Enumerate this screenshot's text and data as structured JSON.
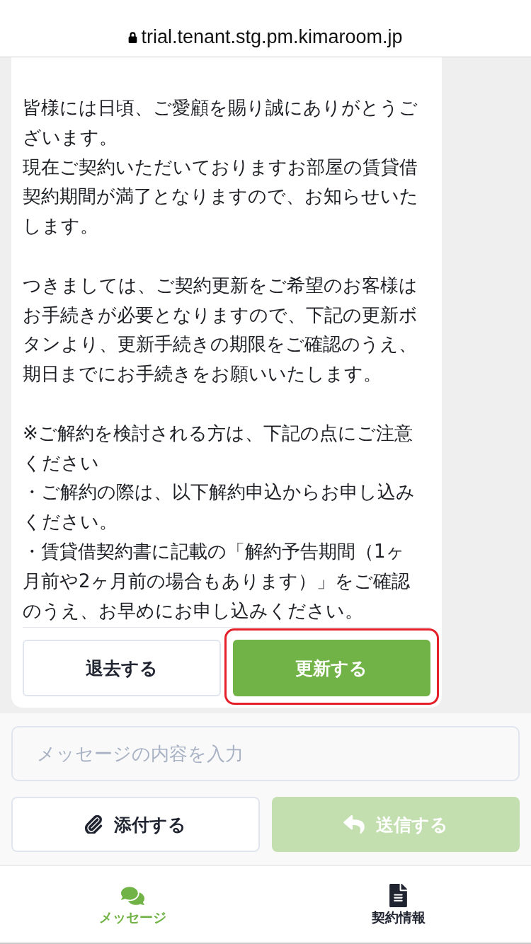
{
  "browser": {
    "url": "trial.tenant.stg.pm.kimaroom.jp",
    "secure": true
  },
  "message": {
    "paragraphs": [
      {
        "lines": [
          "皆様には日頃、ご愛顧を賜り誠にありがとうございます。",
          "現在ご契約いただいておりますお部屋の賃貸借契約期間が満了となりますので、お知らせいたします。"
        ]
      },
      {
        "lines": [
          "つきましては、ご契約更新をご希望のお客様はお手続きが必要となりますので、下記の更新ボタンより、更新手続きの期限をご確認のうえ、期日までにお手続きをお願いいたします。"
        ]
      },
      {
        "lines": [
          "※ご解約を検討される方は、下記の点にご注意ください",
          "・ご解約の際は、以下解約申込からお申し込みください。",
          "・賃貸借契約書に記載の「解約予告期間（1ヶ月前や2ヶ月前の場合もあります）」をご確認のうえ、お早めにお申し込みください。"
        ]
      }
    ],
    "actions": [
      {
        "label": "退去する",
        "kind": "secondary",
        "highlighted": false
      },
      {
        "label": "更新する",
        "kind": "primary",
        "highlighted": true
      }
    ]
  },
  "composer": {
    "placeholder": "メッセージの内容を入力",
    "buttons": [
      {
        "label": "添付する",
        "kind": "attach",
        "disabled": false
      },
      {
        "label": "送信する",
        "kind": "send",
        "disabled": true
      }
    ]
  },
  "tab_bar": [
    {
      "label": "メッセージ",
      "kind": "messages",
      "selected": true
    },
    {
      "label": "契約情報",
      "kind": "contract",
      "selected": false
    }
  ]
}
